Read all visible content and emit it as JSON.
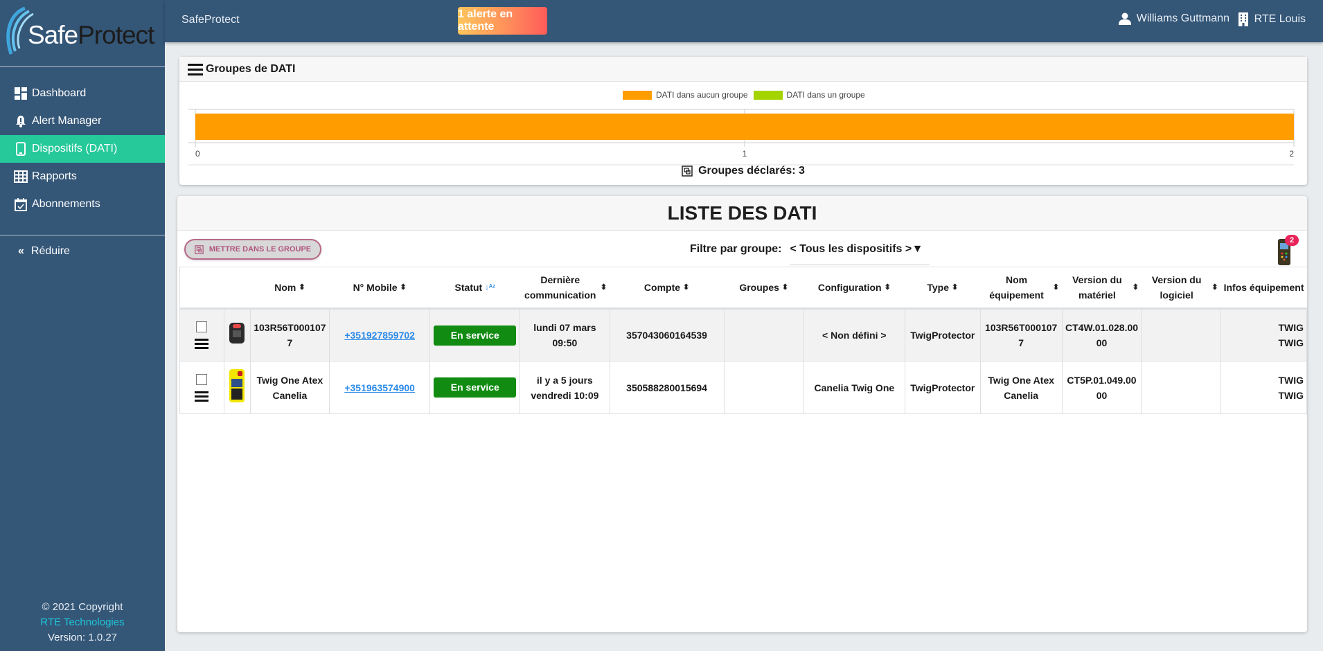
{
  "brand": {
    "logo_safe": "Safe",
    "logo_protect": "Protect",
    "app_name": "SafeProtect"
  },
  "sidebar": {
    "items": [
      {
        "label": "Dashboard",
        "icon": "dashboard-icon",
        "active": false
      },
      {
        "label": "Alert Manager",
        "icon": "bell-icon",
        "active": false
      },
      {
        "label": "Dispositifs (DATI)",
        "icon": "mobile-icon",
        "active": true
      },
      {
        "label": "Rapports",
        "icon": "grid-icon",
        "active": false
      },
      {
        "label": "Abonnements",
        "icon": "calendar-check-icon",
        "active": false
      }
    ],
    "reduce_label": "Réduire",
    "footer": {
      "copyright": "© 2021 Copyright",
      "company_link": "RTE Technologies",
      "version": "Version: 1.0.27"
    }
  },
  "topbar": {
    "alert_button": "1 alerte en attente",
    "user_name": "Williams Guttmann",
    "company_name": "RTE Louis"
  },
  "groups_card": {
    "title": "Groupes de DATI",
    "declared_label": "Groupes déclarés:",
    "declared_count": "3"
  },
  "chart_data": {
    "type": "bar",
    "orientation": "horizontal",
    "stacked": true,
    "title": "",
    "legend": [
      "DATI dans aucun groupe",
      "DATI dans un groupe"
    ],
    "legend_position": "top-center",
    "series": [
      {
        "name": "DATI dans aucun groupe",
        "color": "#ff9c00",
        "values": [
          2
        ]
      },
      {
        "name": "DATI dans un groupe",
        "color": "#a4d400",
        "values": [
          0
        ]
      }
    ],
    "categories": [
      ""
    ],
    "xlim": [
      0,
      2
    ],
    "xticks": [
      "0",
      "1",
      "2"
    ],
    "grid": true
  },
  "list_card": {
    "title": "LISTE DES DATI",
    "group_button": "METTRE DANS LE GROUPE",
    "filter_label": "Filtre par groupe:",
    "filter_value": "< Tous les dispositifs >",
    "device_badge_count": "2"
  },
  "table": {
    "columns": [
      {
        "label": "",
        "sortable": false
      },
      {
        "label": "",
        "sortable": false
      },
      {
        "label": "Nom",
        "sortable": true
      },
      {
        "label": "N° Mobile",
        "sortable": true
      },
      {
        "label": "Statut",
        "sortable": true,
        "sorted": true
      },
      {
        "label": "Dernière communication",
        "sortable": true
      },
      {
        "label": "Compte",
        "sortable": true
      },
      {
        "label": "Groupes",
        "sortable": true
      },
      {
        "label": "Configuration",
        "sortable": true
      },
      {
        "label": "Type",
        "sortable": true
      },
      {
        "label": "Nom équipement",
        "sortable": true
      },
      {
        "label": "Version du matériel",
        "sortable": true
      },
      {
        "label": "Version du logiciel",
        "sortable": true
      },
      {
        "label": "Infos équipement",
        "sortable": false
      }
    ],
    "rows": [
      {
        "device_image": "twig-protector-device",
        "nom": "103R56T0001077",
        "mobile": "+351927859702",
        "statut": "En service",
        "derniere_comm": "lundi 07 mars 09:50",
        "compte": "357043060164539",
        "groupes": "",
        "configuration": "< Non défini >",
        "type": "TwigProtector",
        "nom_equipement": "103R56T0001077",
        "version_materiel": "CT4W.01.028.0000",
        "version_logiciel": "",
        "infos_l1": "TWIG",
        "infos_l2": "TWIG"
      },
      {
        "device_image": "twig-one-atex-device",
        "nom": "Twig One Atex Canelia",
        "mobile": "+351963574900",
        "statut": "En service",
        "derniere_comm": "il y a 5 jours vendredi 10:09",
        "compte": "350588280015694",
        "groupes": "",
        "configuration": "Canelia Twig One",
        "type": "TwigProtector",
        "nom_equipement": "Twig One Atex Canelia",
        "version_materiel": "CT5P.01.049.0000",
        "version_logiciel": "",
        "infos_l1": "TWIG",
        "infos_l2": "TWIG"
      }
    ]
  }
}
